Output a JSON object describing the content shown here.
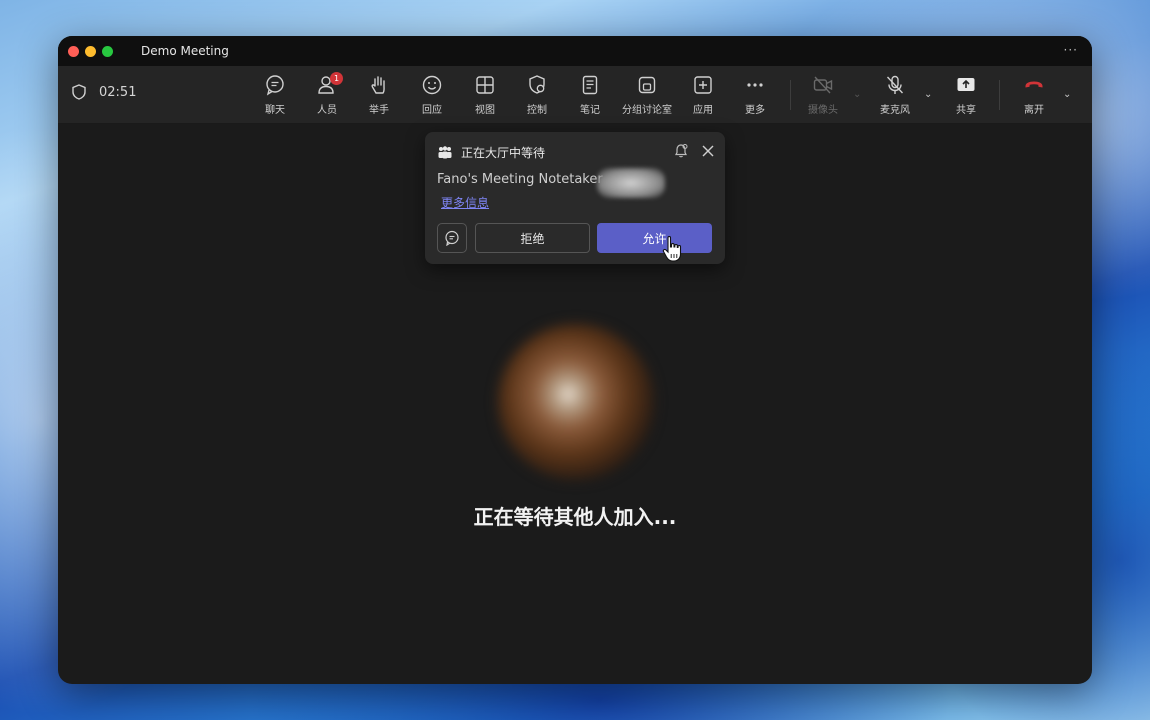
{
  "window": {
    "title": "Demo Meeting",
    "more": "···"
  },
  "toolbar": {
    "timer": "02:51",
    "tools": [
      {
        "label": "聊天",
        "icon": "chat-icon"
      },
      {
        "label": "人员",
        "icon": "people-icon",
        "badge": "1"
      },
      {
        "label": "举手",
        "icon": "raise-hand-icon"
      },
      {
        "label": "回应",
        "icon": "react-icon"
      },
      {
        "label": "视图",
        "icon": "view-icon"
      },
      {
        "label": "控制",
        "icon": "control-icon"
      },
      {
        "label": "笔记",
        "icon": "notes-icon"
      },
      {
        "label": "分组讨论室",
        "icon": "breakout-icon"
      },
      {
        "label": "应用",
        "icon": "apps-icon"
      },
      {
        "label": "更多",
        "icon": "more-icon"
      },
      {
        "label": "摄像头",
        "icon": "camera-off-icon"
      },
      {
        "label": "麦克风",
        "icon": "mic-off-icon"
      },
      {
        "label": "共享",
        "icon": "share-icon"
      },
      {
        "label": "离开",
        "icon": "leave-icon"
      }
    ]
  },
  "lobby": {
    "title": "正在大厅中等待",
    "participant": "Fano's Meeting Notetaker",
    "more_info": "更多信息",
    "deny": "拒绝",
    "allow": "允许"
  },
  "main": {
    "waiting_text": "正在等待其他人加入..."
  },
  "colors": {
    "accent": "#5b5fc7",
    "leave": "#d13438",
    "badge": "#d13438"
  }
}
